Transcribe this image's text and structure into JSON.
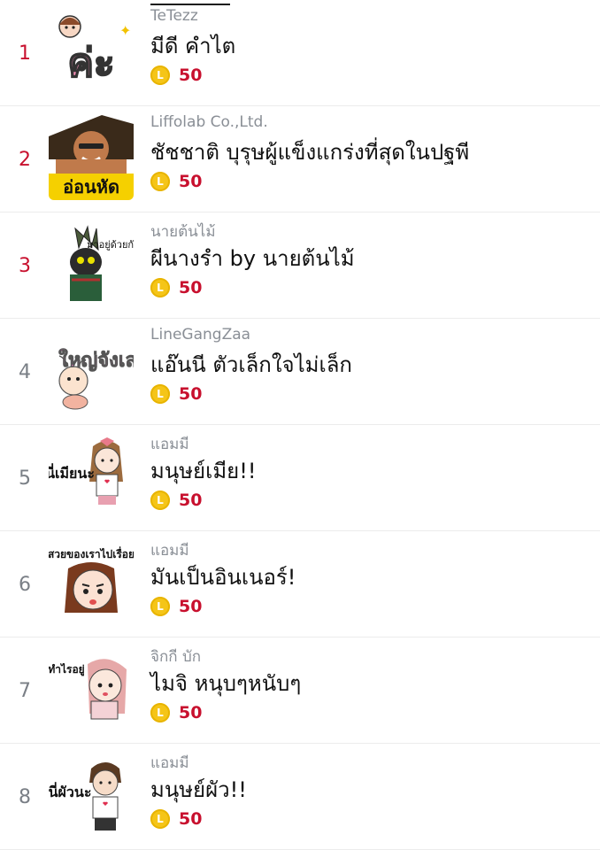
{
  "stickers": [
    {
      "rank": "1",
      "author": "TeTezz",
      "title": "มีดี คำไต",
      "price": "50",
      "coin_letter": "L",
      "thumb_text": "ค่ะ",
      "thumb_icon": "pink-girl-sticker-icon"
    },
    {
      "rank": "2",
      "author": "Liffolab Co.,Ltd.",
      "title": "ชัชชาติ บุรุษผู้แข็งแกร่งที่สุดในปฐพี",
      "price": "50",
      "coin_letter": "L",
      "thumb_text": "อ่อนหัด",
      "thumb_icon": "strongman-sticker-icon"
    },
    {
      "rank": "3",
      "author": "นายต้นไม้",
      "title": "ผีนางรำ by นายต้นไม้",
      "price": "50",
      "coin_letter": "L",
      "thumb_text": "มาอยู่ด้วยกัน~",
      "thumb_icon": "ghost-dancer-sticker-icon"
    },
    {
      "rank": "4",
      "author": "LineGangZaa",
      "title": "แอ๊นนี ตัวเล็กใจไม่เล็ก",
      "price": "50",
      "coin_letter": "L",
      "thumb_text": "ใหญ่จังเลย",
      "thumb_icon": "ant-sticker-icon"
    },
    {
      "rank": "5",
      "author": "แอมมี",
      "title": "มนุษย์เมีย!!",
      "price": "50",
      "coin_letter": "L",
      "thumb_text": "นี่เมียนะ",
      "thumb_icon": "wife-girl-sticker-icon"
    },
    {
      "rank": "6",
      "author": "แอมมี",
      "title": "มันเป็นอินเนอร์!",
      "price": "50",
      "coin_letter": "L",
      "thumb_text": "สวยของเราไปเรื่อย",
      "thumb_icon": "inner-girl-sticker-icon"
    },
    {
      "rank": "7",
      "author": "จิกกี บัก",
      "title": "ไมจิ หนุบๆหนับๆ",
      "price": "50",
      "coin_letter": "L",
      "thumb_text": "ทำไรอยู่",
      "thumb_icon": "cute-girl-sticker-icon"
    },
    {
      "rank": "8",
      "author": "แอมมี",
      "title": "มนุษย์ผัว!!",
      "price": "50",
      "coin_letter": "L",
      "thumb_text": "นี่ผัวนะ",
      "thumb_icon": "husband-boy-sticker-icon"
    }
  ],
  "colors": {
    "rank_top": "#c8102e",
    "rank_other": "#7a7f86",
    "price": "#c8102e",
    "coin": "#f5c518"
  }
}
